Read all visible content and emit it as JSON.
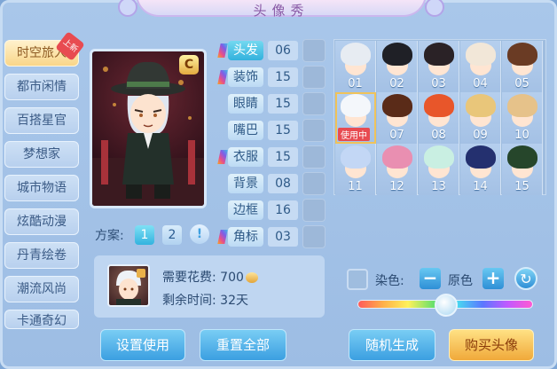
{
  "title": "头像秀",
  "categories": [
    {
      "label": "时空旅人",
      "active": true,
      "badge": "上新"
    },
    {
      "label": "都市闲情"
    },
    {
      "label": "百搭星官"
    },
    {
      "label": "梦想家"
    },
    {
      "label": "城市物语"
    },
    {
      "label": "炫酷动漫"
    },
    {
      "label": "丹青绘卷"
    },
    {
      "label": "潮流风尚"
    },
    {
      "label": "卡通奇幻"
    }
  ],
  "preview": {
    "mark": "C"
  },
  "parts": [
    {
      "label": "头发",
      "value": "06",
      "selected": true,
      "flag": true
    },
    {
      "label": "装饰",
      "value": "15",
      "flag": true
    },
    {
      "label": "眼睛",
      "value": "15"
    },
    {
      "label": "嘴巴",
      "value": "15"
    },
    {
      "label": "衣服",
      "value": "15",
      "flag": true
    },
    {
      "label": "背景",
      "value": "08"
    },
    {
      "label": "边框",
      "value": "16"
    },
    {
      "label": "角标",
      "value": "03",
      "flag": true
    }
  ],
  "hair_options": [
    {
      "num": "01",
      "color": "#e7ecf2"
    },
    {
      "num": "02",
      "color": "#1f2026"
    },
    {
      "num": "03",
      "color": "#2a2226"
    },
    {
      "num": "04",
      "color": "#f2e7d8"
    },
    {
      "num": "05",
      "color": "#6a3b24"
    },
    {
      "num": "06",
      "color": "#f4f7fb",
      "using": true,
      "using_label": "使用中"
    },
    {
      "num": "07",
      "color": "#5a2b18"
    },
    {
      "num": "08",
      "color": "#e8562a"
    },
    {
      "num": "09",
      "color": "#e9c67a"
    },
    {
      "num": "10",
      "color": "#e6c28a"
    },
    {
      "num": "11",
      "color": "#c3d7f5"
    },
    {
      "num": "12",
      "color": "#e98fb1"
    },
    {
      "num": "13",
      "color": "#c9efe2"
    },
    {
      "num": "14",
      "color": "#24306f"
    },
    {
      "num": "15",
      "color": "#26462b"
    }
  ],
  "scheme": {
    "label": "方案:",
    "options": [
      "1",
      "2"
    ],
    "info": "!"
  },
  "cost": {
    "price_label": "需要花费: 700",
    "time_label": "剩余时间: 32天"
  },
  "dye": {
    "label": "染色:",
    "minus": "−",
    "original": "原色",
    "plus": "+",
    "refresh": "↻",
    "level": 0.5
  },
  "buttons": {
    "set_use": "设置使用",
    "reset_all": "重置全部",
    "random": "随机生成",
    "buy": "购买头像"
  },
  "colors": {
    "accent": "#33b1dd",
    "gold": "#f0a93a",
    "badge_red": "#e84b51"
  }
}
